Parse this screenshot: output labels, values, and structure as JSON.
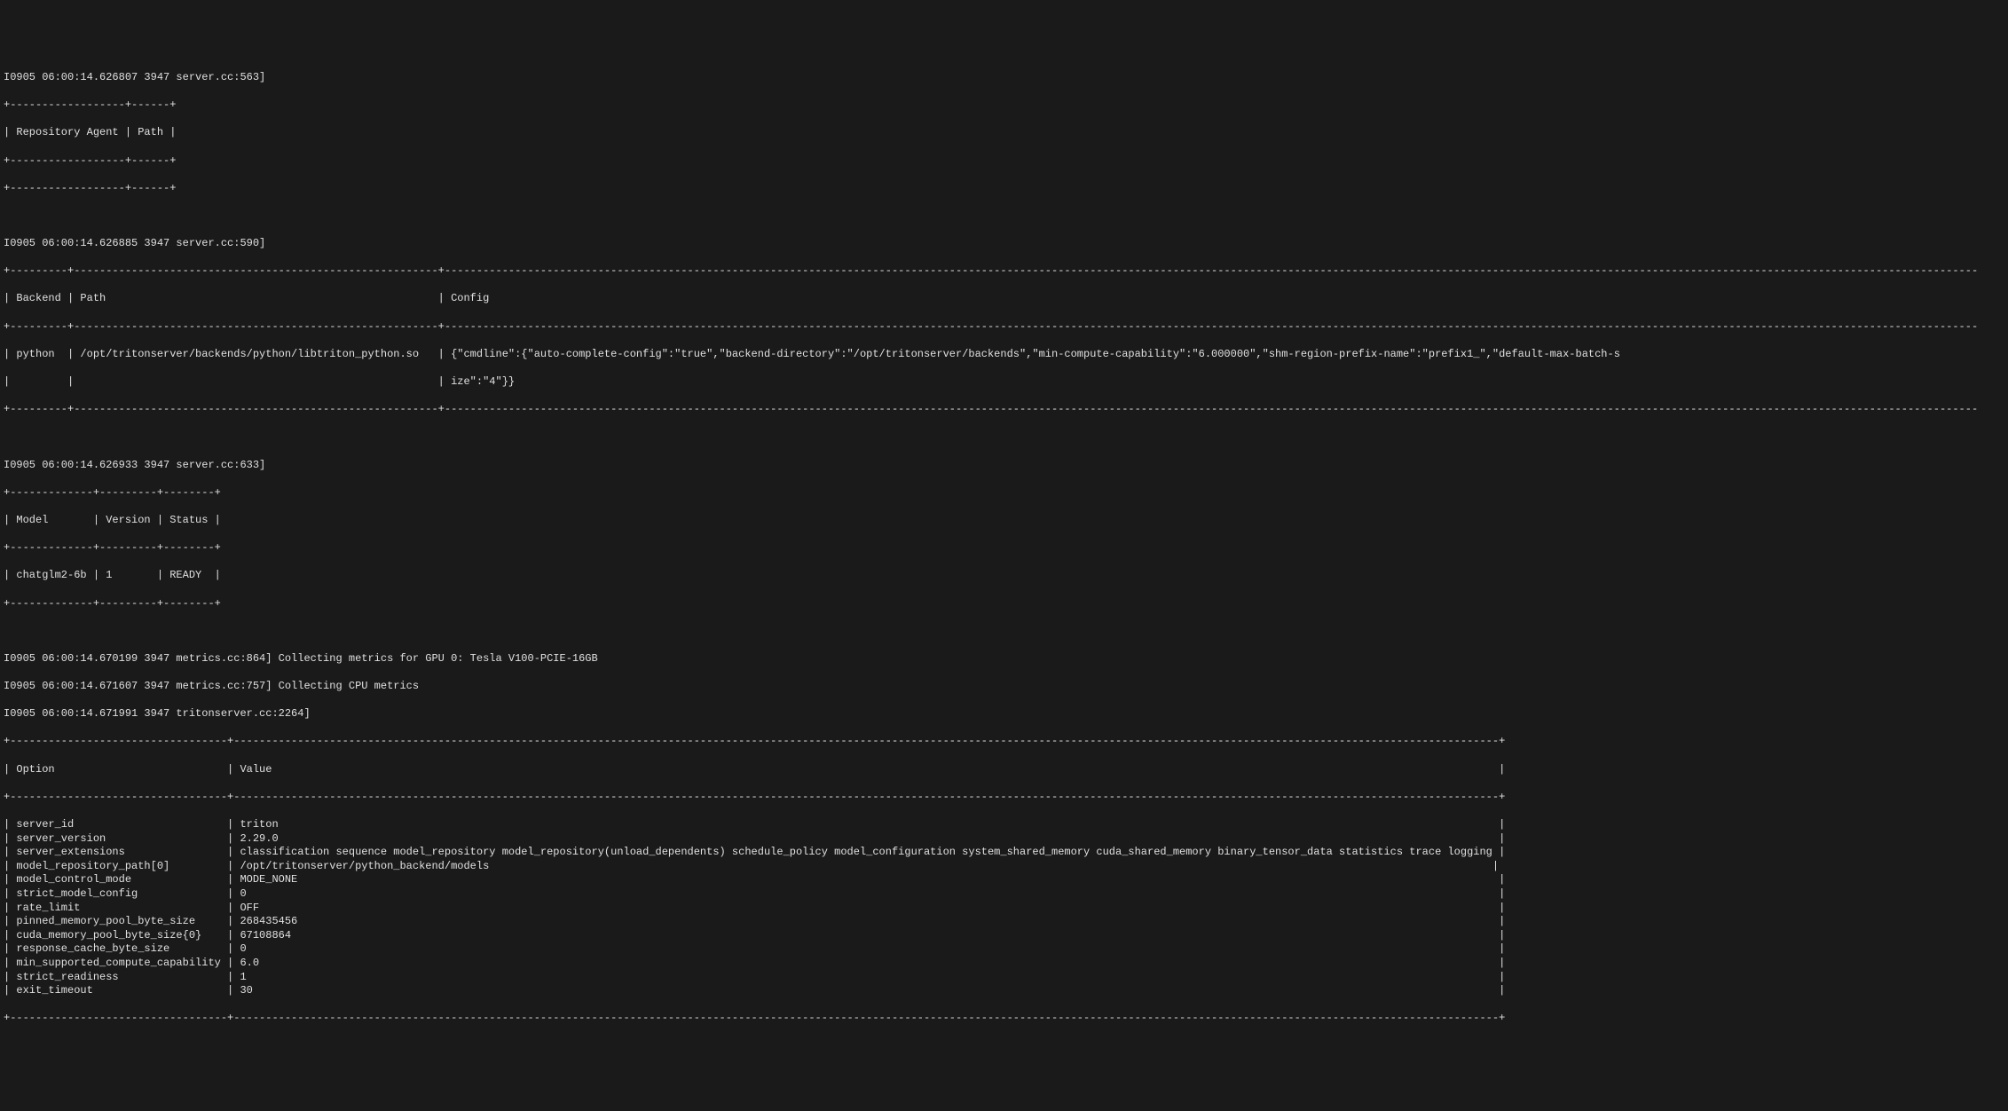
{
  "log1": {
    "header": "I0905 06:00:14.626807 3947 server.cc:563]",
    "table_top": "+------------------+------+",
    "table_header": "| Repository Agent | Path |",
    "table_mid": "+------------------+------+",
    "table_bottom": "+------------------+------+"
  },
  "log2": {
    "header": "I0905 06:00:14.626885 3947 server.cc:590]",
    "table_top": "+---------+---------------------------------------------------------+------------------------------------------------------------------------------------------------------------------------------------------------------------------------------------------------------------------------------------------------",
    "table_header": "| Backend | Path                                                    | Config",
    "table_mid": "+---------+---------------------------------------------------------+------------------------------------------------------------------------------------------------------------------------------------------------------------------------------------------------------------------------------------------------",
    "table_row1": "| python  | /opt/tritonserver/backends/python/libtriton_python.so   | {\"cmdline\":{\"auto-complete-config\":\"true\",\"backend-directory\":\"/opt/tritonserver/backends\",\"min-compute-capability\":\"6.000000\",\"shm-region-prefix-name\":\"prefix1_\",\"default-max-batch-s",
    "table_row2": "|         |                                                         | ize\":\"4\"}}",
    "table_bottom": "+---------+---------------------------------------------------------+------------------------------------------------------------------------------------------------------------------------------------------------------------------------------------------------------------------------------------------------"
  },
  "log3": {
    "header": "I0905 06:00:14.626933 3947 server.cc:633]",
    "table_top": "+-------------+---------+--------+",
    "table_header": "| Model       | Version | Status |",
    "table_mid": "+-------------+---------+--------+",
    "table_row": "| chatglm2-6b | 1       | READY  |",
    "table_bottom": "+-------------+---------+--------+"
  },
  "log4": {
    "line1": "I0905 06:00:14.670199 3947 metrics.cc:864] Collecting metrics for GPU 0: Tesla V100-PCIE-16GB",
    "line2": "I0905 06:00:14.671607 3947 metrics.cc:757] Collecting CPU metrics",
    "line3": "I0905 06:00:14.671991 3947 tritonserver.cc:2264]"
  },
  "options_table": {
    "top": "+----------------------------------+------------------------------------------------------------------------------------------------------------------------------------------------------------------------------------------------------+",
    "header": "| Option                           | Value                                                                                                                                                                                                |",
    "mid": "+----------------------------------+------------------------------------------------------------------------------------------------------------------------------------------------------------------------------------------------------+",
    "rows": [
      "| server_id                        | triton                                                                                                                                                                                               |",
      "| server_version                   | 2.29.0                                                                                                                                                                                               |",
      "| server_extensions                | classification sequence model_repository model_repository(unload_dependents) schedule_policy model_configuration system_shared_memory cuda_shared_memory binary_tensor_data statistics trace logging |",
      "| model_repository_path[0]         | /opt/tritonserver/python_backend/models                                                                                                                                                             |",
      "| model_control_mode               | MODE_NONE                                                                                                                                                                                            |",
      "| strict_model_config              | 0                                                                                                                                                                                                    |",
      "| rate_limit                       | OFF                                                                                                                                                                                                  |",
      "| pinned_memory_pool_byte_size     | 268435456                                                                                                                                                                                            |",
      "| cuda_memory_pool_byte_size{0}    | 67108864                                                                                                                                                                                             |",
      "| response_cache_byte_size         | 0                                                                                                                                                                                                    |",
      "| min_supported_compute_capability | 6.0                                                                                                                                                                                                  |",
      "| strict_readiness                 | 1                                                                                                                                                                                                    |",
      "| exit_timeout                     | 30                                                                                                                                                                                                   |"
    ],
    "bottom": "+----------------------------------+------------------------------------------------------------------------------------------------------------------------------------------------------------------------------------------------------+"
  }
}
